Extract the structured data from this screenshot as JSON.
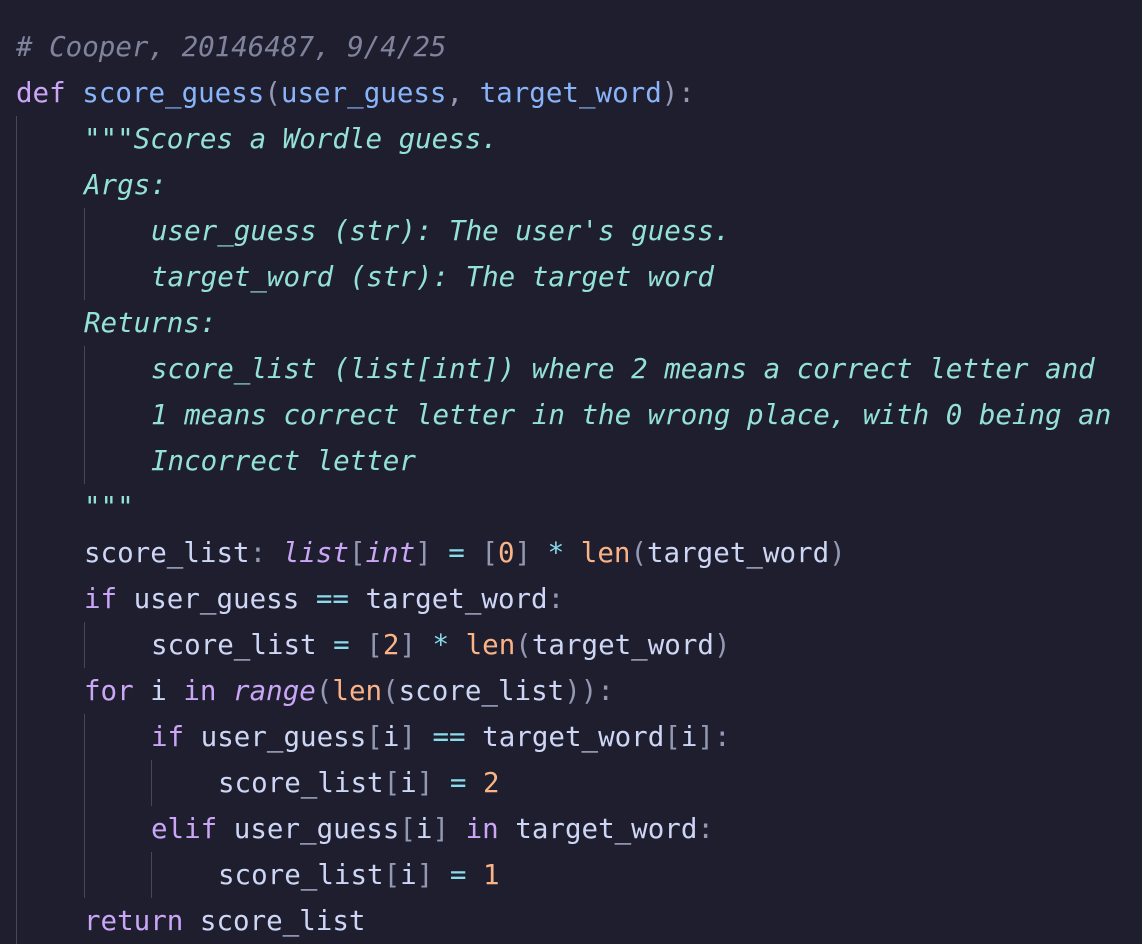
{
  "editor": {
    "theme_colors": {
      "background": "#1e1e2e",
      "comment": "#7f849c",
      "keyword": "#cba6f7",
      "function": "#89b4fa",
      "docstring": "#94e2d5",
      "number": "#fab387",
      "text": "#cdd6f4",
      "indent_guide": "#45475a"
    },
    "lines": {
      "l1": {
        "comment": "# Cooper, 20146487, 9/4/25"
      },
      "l2": {
        "kw": "def",
        "name": "score_guess",
        "open": "(",
        "p1": "user_guess",
        "sep": ", ",
        "p2": "target_word",
        "close": "):"
      },
      "l3": {
        "doc": "\"\"\"Scores a Wordle guess."
      },
      "l4": {
        "doc": "Args:"
      },
      "l5": {
        "doc": "user_guess (str): The user's guess."
      },
      "l6": {
        "doc": "target_word (str): The target word"
      },
      "l7": {
        "doc": "Returns:"
      },
      "l8": {
        "doc": "score_list (list[int]) where 2 means a correct letter and"
      },
      "l9": {
        "doc": "1 means correct letter in the wrong place, with 0 being an"
      },
      "l10": {
        "doc": "Incorrect letter"
      },
      "l11": {
        "doc": "\"\"\""
      },
      "l12": {
        "a": "score_list",
        "b": ": ",
        "c": "list",
        "d": "[",
        "e": "int",
        "f": "]",
        "g": " = ",
        "h": "[",
        "i": "0",
        "j": "]",
        "k": " * ",
        "l": "len",
        "m": "(",
        "n": "target_word",
        "o": ")"
      },
      "l13": {
        "a": "if",
        "b": " user_guess ",
        "c": "==",
        "d": " target_word",
        "e": ":"
      },
      "l14": {
        "a": "score_list",
        "b": " = ",
        "c": "[",
        "d": "2",
        "e": "]",
        "f": " * ",
        "g": "len",
        "h": "(",
        "i": "target_word",
        "j": ")"
      },
      "l15": {
        "a": "for",
        "b": " i ",
        "c": "in",
        "d": " ",
        "e": "range",
        "f": "(",
        "g": "len",
        "h": "(",
        "i": "score_list",
        "j": "))",
        "k": ":"
      },
      "l16": {
        "a": "if",
        "b": " user_guess",
        "c": "[",
        "d": "i",
        "e": "]",
        "f": " == ",
        "g": "target_word",
        "h": "[",
        "i": "i",
        "j": "]:"
      },
      "l17": {
        "a": "score_list",
        "b": "[",
        "c": "i",
        "d": "]",
        "e": " = ",
        "f": "2"
      },
      "l18": {
        "a": "elif",
        "b": " user_guess",
        "c": "[",
        "d": "i",
        "e": "]",
        "f": " ",
        "g": "in",
        "h": " target_word",
        "i": ":"
      },
      "l19": {
        "a": "score_list",
        "b": "[",
        "c": "i",
        "d": "]",
        "e": " = ",
        "f": "1"
      },
      "l20": {
        "a": "return",
        "b": " score_list"
      }
    }
  }
}
